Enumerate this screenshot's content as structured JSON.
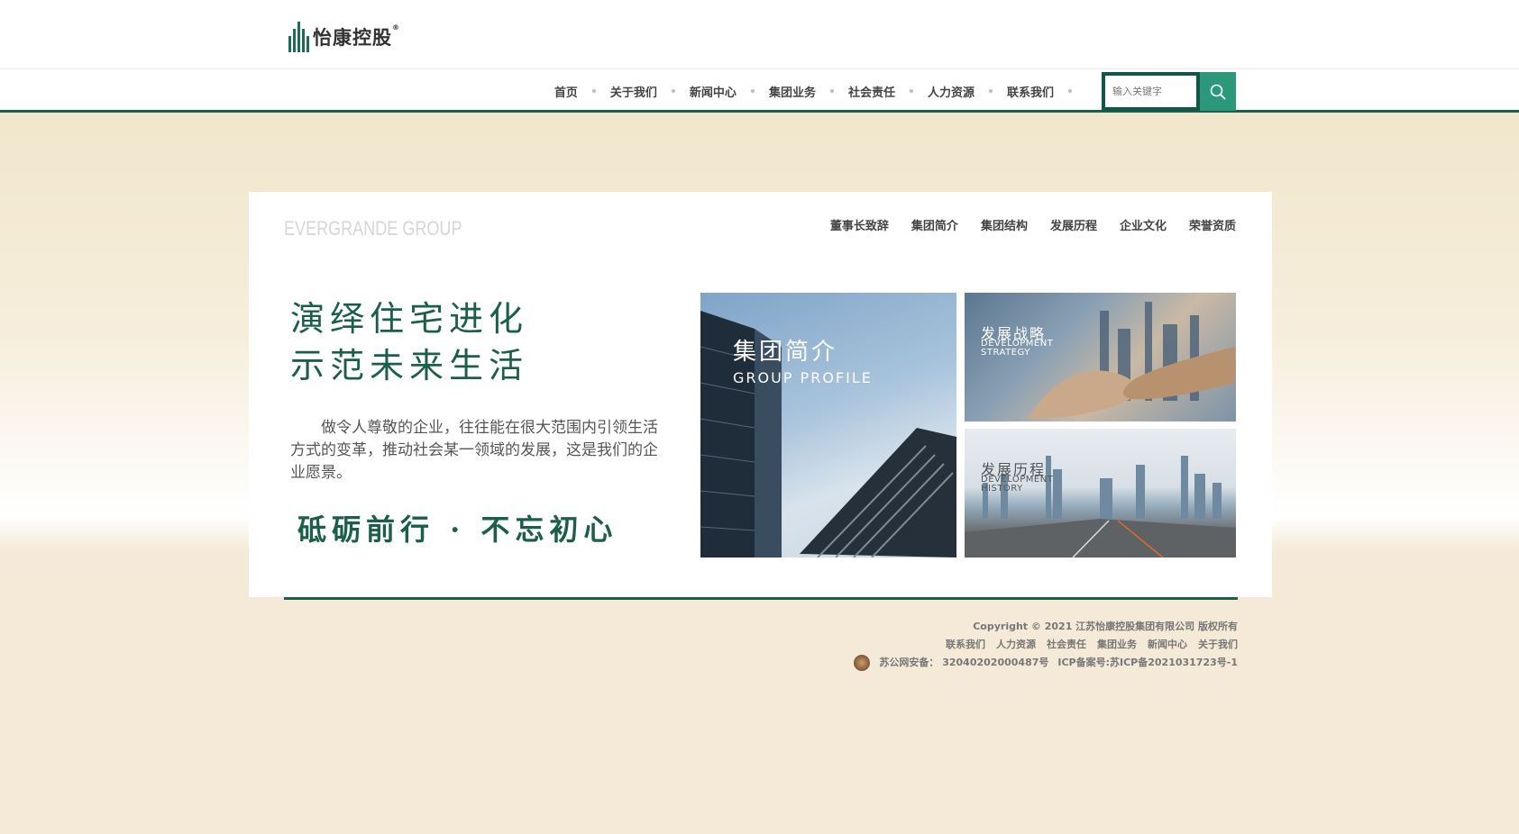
{
  "header": {
    "logo_text": "怡康控股",
    "logo_mark": "®"
  },
  "nav": {
    "items": [
      "首页",
      "关于我们",
      "新闻中心",
      "集团业务",
      "社会责任",
      "人力资源",
      "联系我们"
    ]
  },
  "search": {
    "placeholder": "输入关键字",
    "icon": "search-icon"
  },
  "card": {
    "brand_en": "EVERGRANDE GROUP",
    "subnav": [
      "董事长致辞",
      "集团简介",
      "集团结构",
      "发展历程",
      "企业文化",
      "荣誉资质"
    ],
    "headline_line1": "演绎住宅进化",
    "headline_line2": "示范未来生活",
    "intro": "做令人尊敬的企业，往往能在很大范围内引领生活方式的变革，推动社会某一领域的发展，这是我们的企业愿景。",
    "motto": "砥砺前行 · 不忘初心",
    "tiles": {
      "profile": {
        "cn": "集团简介",
        "en": "GROUP PROFILE"
      },
      "strategy": {
        "cn": "发展战略",
        "en": "DEVELOPMENT STRATEGY"
      },
      "history": {
        "cn": "发展历程",
        "en": "DEVELOPMENT HISTORY"
      }
    }
  },
  "footer": {
    "copyright": "Copyright © 2021 江苏怡康控股集团有限公司 版权所有",
    "links": [
      "联系我们",
      "人力资源",
      "社会责任",
      "集团业务",
      "新闻中心",
      "关于我们"
    ],
    "police_record": "苏公网安备： 32040202000487号",
    "icp_record": "ICP备案号:苏ICP备2021031723号-1"
  },
  "colors": {
    "brand_green": "#1b5e4a",
    "search_button": "#2a9879",
    "background_beige": "#efe3c5"
  }
}
